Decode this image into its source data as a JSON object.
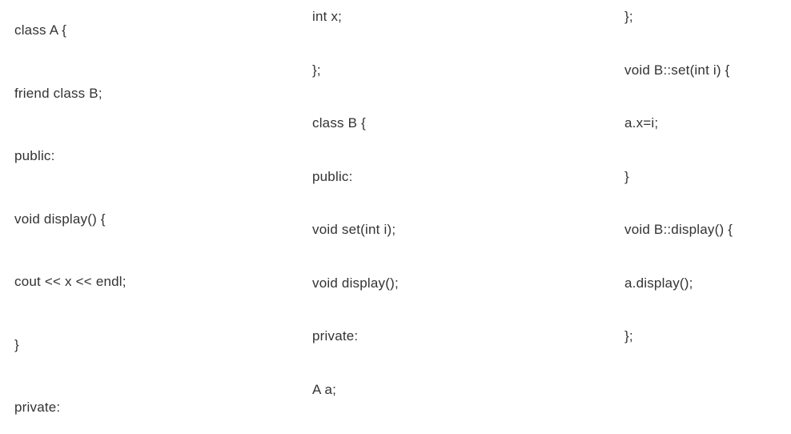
{
  "columns": {
    "col1": [
      "class A {",
      "friend class B;",
      "public:",
      "void display() {",
      "cout << x << endl;",
      "}",
      "private:"
    ],
    "col2": [
      "int x;",
      "};",
      "class B {",
      "public:",
      "void set(int i);",
      "void display();",
      "private:",
      "A a;"
    ],
    "col3": [
      "};",
      "void B::set(int i) {",
      "a.x=i;",
      "}",
      "void B::display() {",
      "a.display();",
      "};"
    ]
  }
}
